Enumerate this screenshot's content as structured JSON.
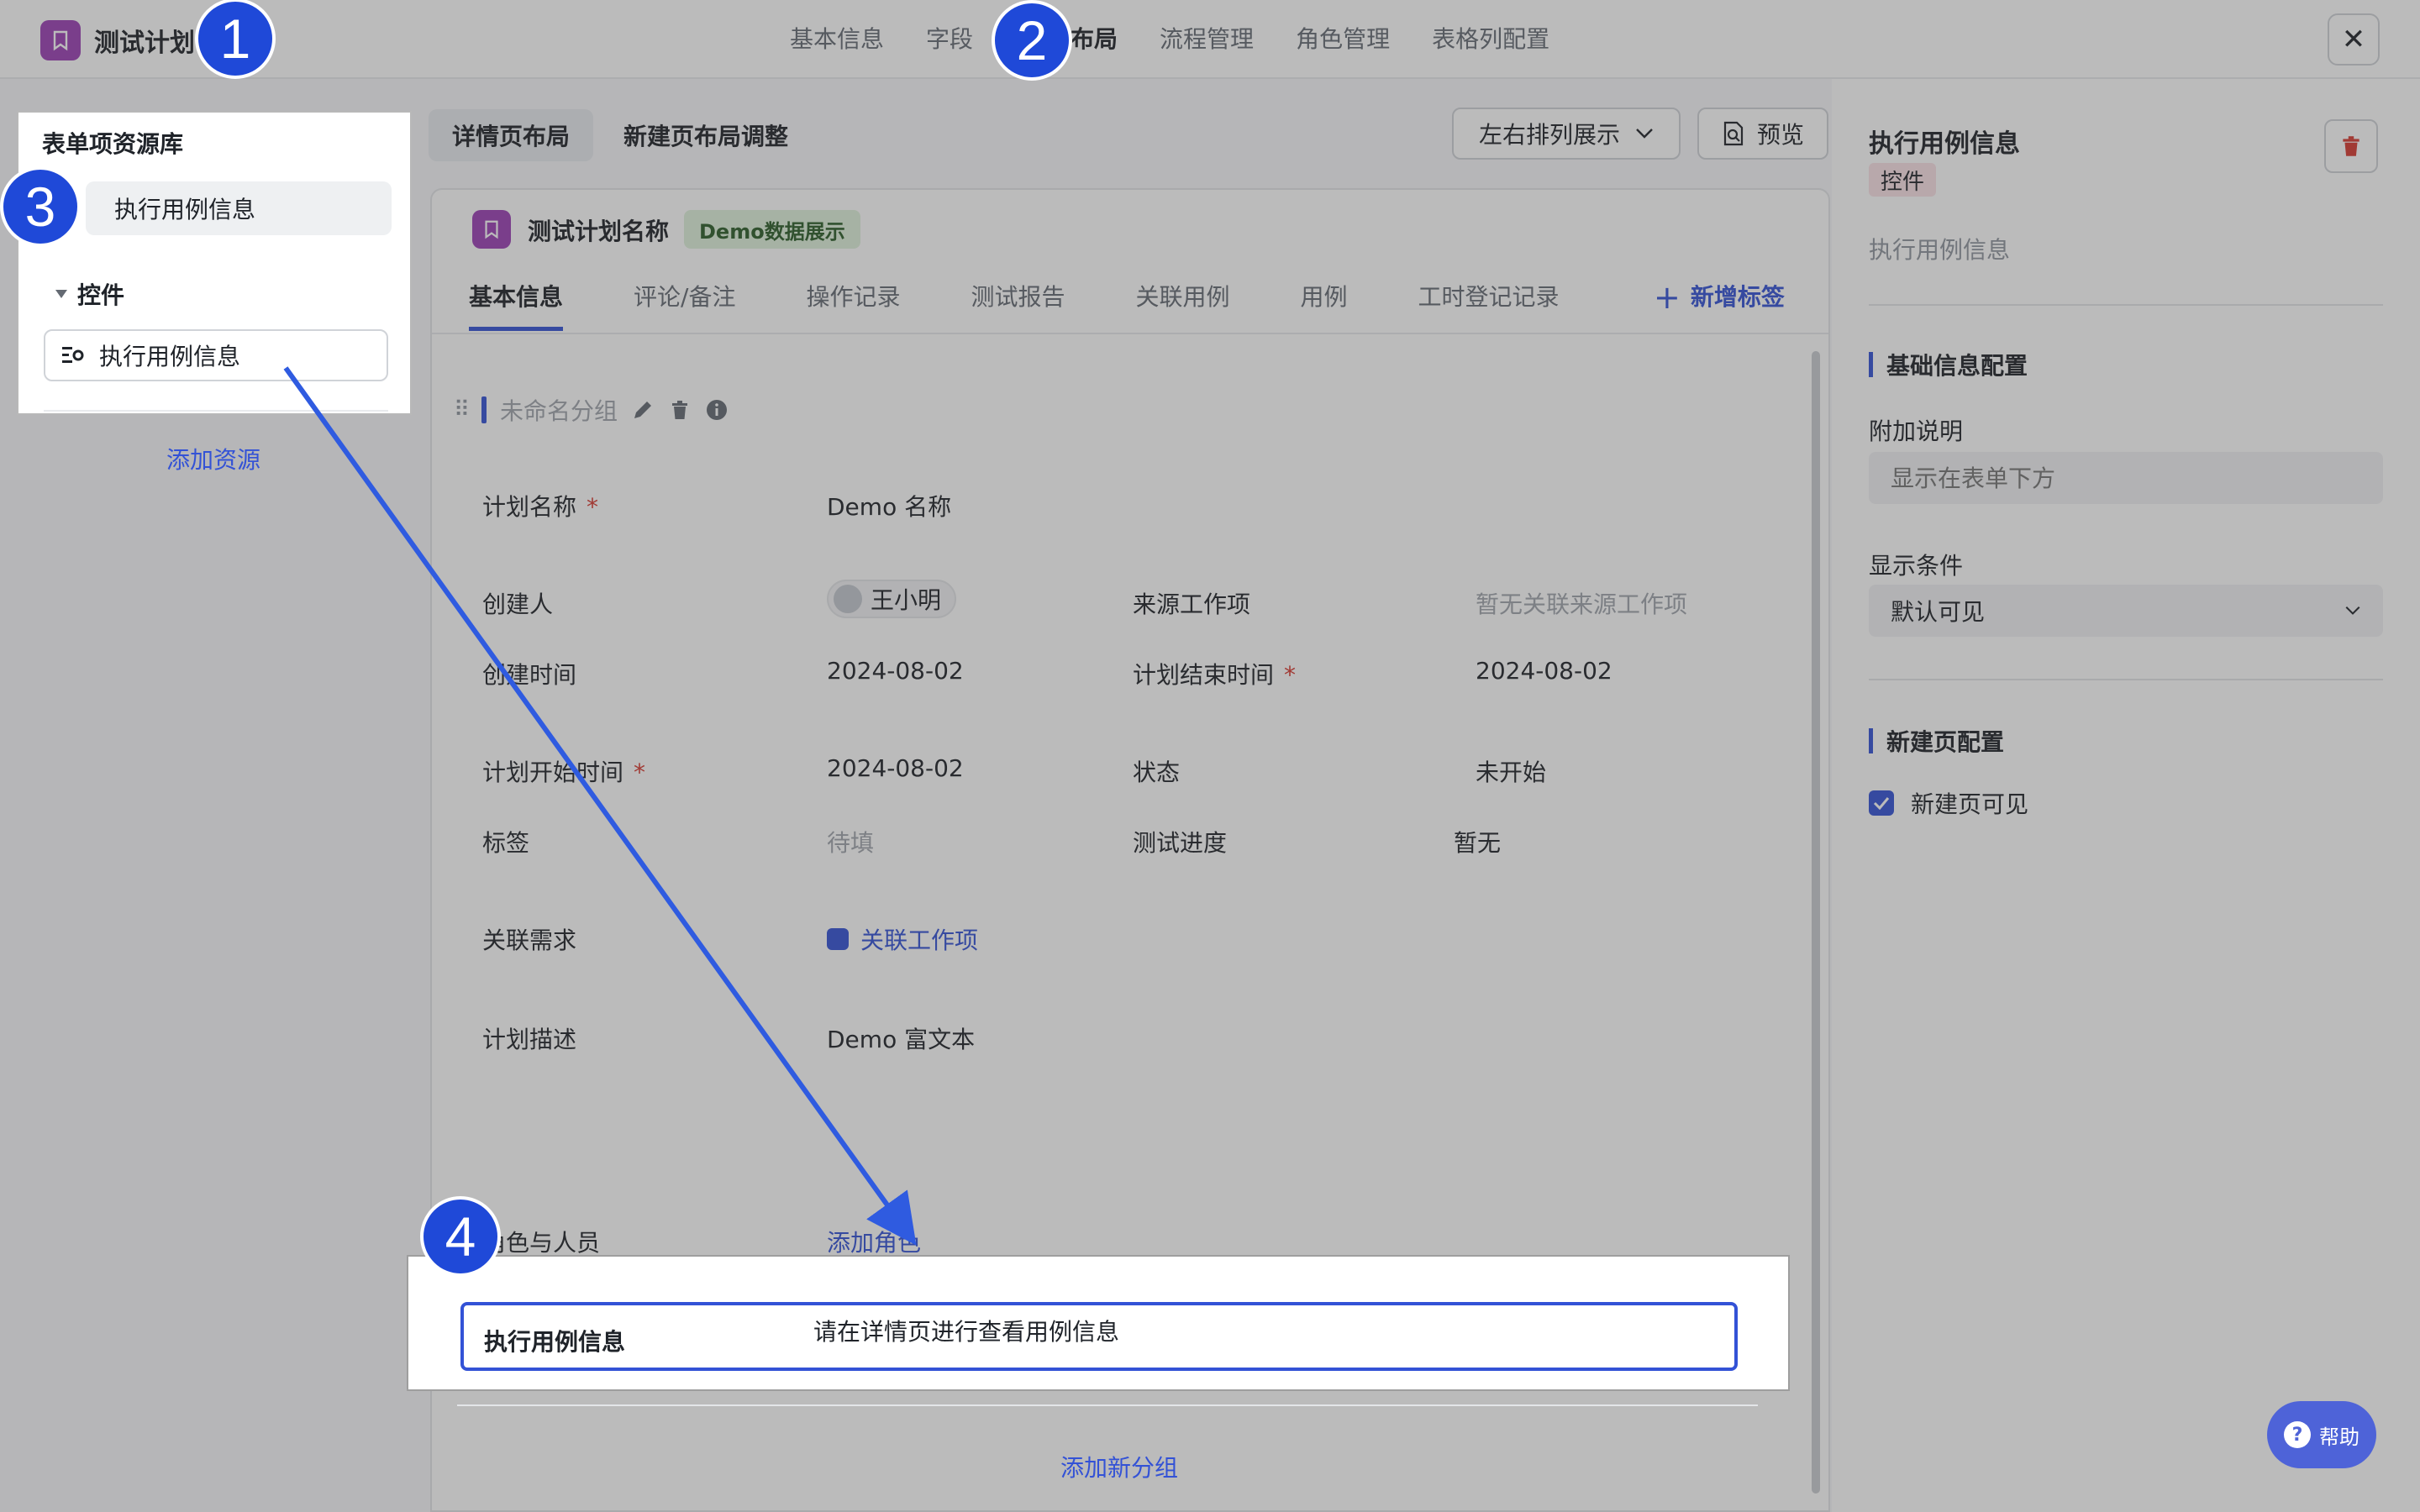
{
  "header": {
    "app_title": "测试计划",
    "tabs": [
      "基本信息",
      "字段",
      "页面布局",
      "流程管理",
      "角色管理",
      "表格列配置"
    ],
    "active_tab": "页面布局",
    "close_icon": "✕"
  },
  "left_panel": {
    "title": "表单项资源库",
    "item": "执行用例信息",
    "section": "控件",
    "control_item": "执行用例信息",
    "add_resource": "添加资源"
  },
  "toolbar": {
    "detail_layout": "详情页布局",
    "new_layout": "新建页布局调整",
    "layout_mode": "左右排列展示",
    "preview": "预览"
  },
  "form": {
    "title": "测试计划名称",
    "badge": "Demo数据展示",
    "tabs": [
      "基本信息",
      "评论/备注",
      "操作记录",
      "测试报告",
      "关联用例",
      "用例",
      "工时登记记录"
    ],
    "add_tab": "新增标签",
    "group_name": "未命名分组",
    "fields": {
      "plan_name_label": "计划名称",
      "plan_name_value": "Demo 名称",
      "creator_label": "创建人",
      "creator_value": "王小明",
      "source_label": "来源工作项",
      "source_value": "暂无关联来源工作项",
      "created_label": "创建时间",
      "created_value": "2024-08-02",
      "end_label": "计划结束时间",
      "end_value": "2024-08-02",
      "start_label": "计划开始时间",
      "start_value": "2024-08-02",
      "status_label": "状态",
      "status_value": "未开始",
      "tag_label": "标签",
      "tag_value": "待填",
      "progress_label": "测试进度",
      "progress_value": "暂无",
      "req_label": "关联需求",
      "req_value": "关联工作项",
      "desc_label": "计划描述",
      "desc_value": "Demo 富文本",
      "roles_label": "角色与人员",
      "roles_value": "添加角色",
      "required_mark": "*"
    },
    "exec_label": "执行用例信息",
    "exec_value": "请在详情页进行查看用例信息",
    "add_group": "添加新分组"
  },
  "right_panel": {
    "title": "执行用例信息",
    "tag": "控件",
    "subtitle": "执行用例信息",
    "basic_section": "基础信息配置",
    "note_label": "附加说明",
    "note_placeholder": "显示在表单下方",
    "cond_label": "显示条件",
    "cond_value": "默认可见",
    "new_section": "新建页配置",
    "new_visible": "新建页可见"
  },
  "help": "帮助",
  "steps": [
    "1",
    "2",
    "3",
    "4"
  ],
  "colors": {
    "accent": "#3352d6",
    "step": "#1f49d8",
    "brand_icon": "#9b3fb6"
  }
}
